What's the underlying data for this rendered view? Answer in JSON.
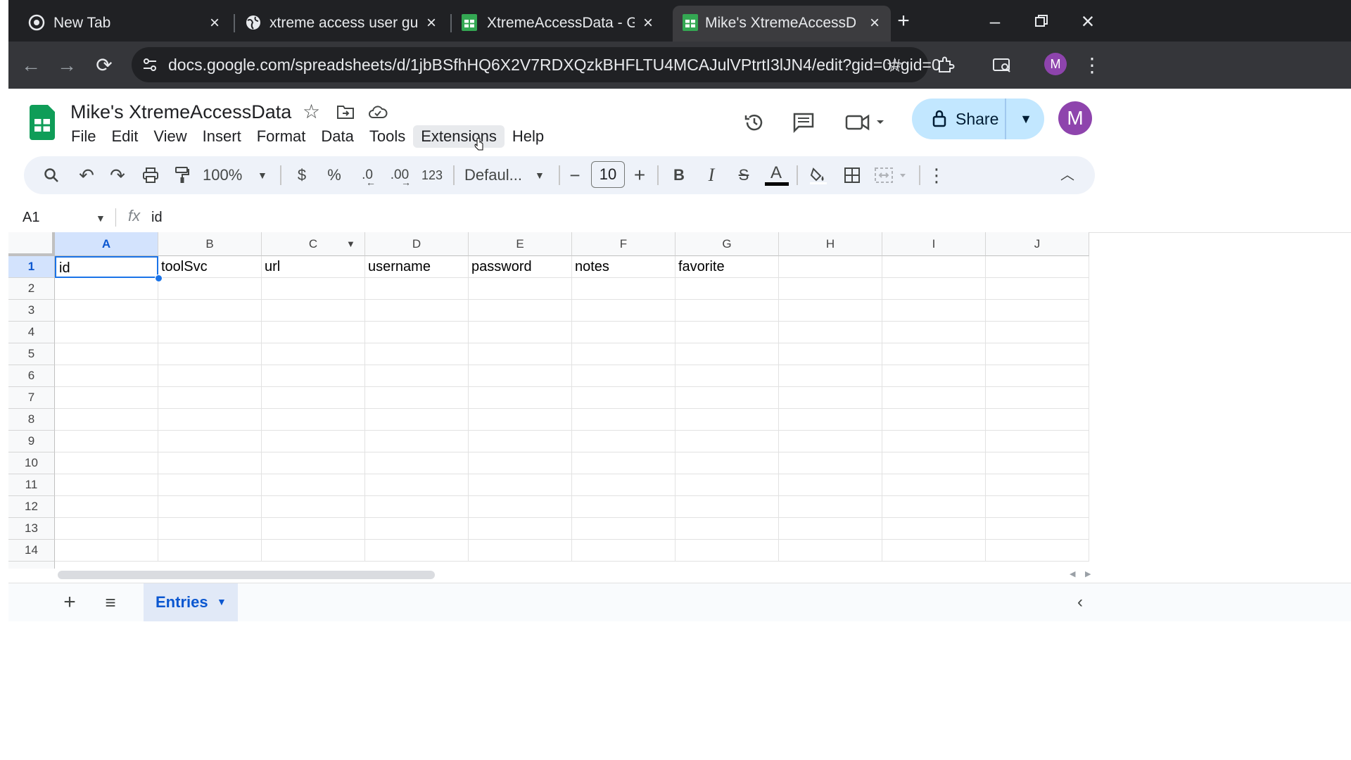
{
  "browser": {
    "tabs": [
      {
        "title": "New Tab"
      },
      {
        "title": "xtreme access user guide -"
      },
      {
        "title": "XtremeAccessData - Googl"
      },
      {
        "title": "Mike's XtremeAccessData"
      }
    ],
    "url": "docs.google.com/spreadsheets/d/1jbBSfhHQ6X2V7RDXQzkBHFLTU4MCAJulVPtrtI3lJN4/edit?gid=0#gid=0",
    "profile_initial": "M"
  },
  "sheets": {
    "doc_title": "Mike's XtremeAccessData",
    "menu": [
      "File",
      "Edit",
      "View",
      "Insert",
      "Format",
      "Data",
      "Tools",
      "Extensions",
      "Help"
    ],
    "hovered_menu": "Extensions",
    "share_label": "Share",
    "avatar_initial": "M",
    "toolbar": {
      "zoom": "100%",
      "currency": "$",
      "percent": "%",
      "dec_decrease": ".0",
      "dec_increase": ".00",
      "number_format": "123",
      "font": "Defaul...",
      "font_size": "10",
      "bold": "B",
      "italic": "I",
      "strike": "S",
      "text_color": "A"
    },
    "name_box": "A1",
    "fx_label": "fx",
    "formula": "id",
    "columns": [
      "A",
      "B",
      "C",
      "D",
      "E",
      "F",
      "G",
      "H",
      "I",
      "J"
    ],
    "rows": [
      "1",
      "2",
      "3",
      "4",
      "5",
      "6",
      "7",
      "8",
      "9",
      "10",
      "11",
      "12",
      "13",
      "14"
    ],
    "header_row": [
      "id",
      "toolSvc",
      "url",
      "username",
      "password",
      "notes",
      "favorite"
    ],
    "sheet_tab": "Entries",
    "accent_color": "#1a73e8"
  }
}
